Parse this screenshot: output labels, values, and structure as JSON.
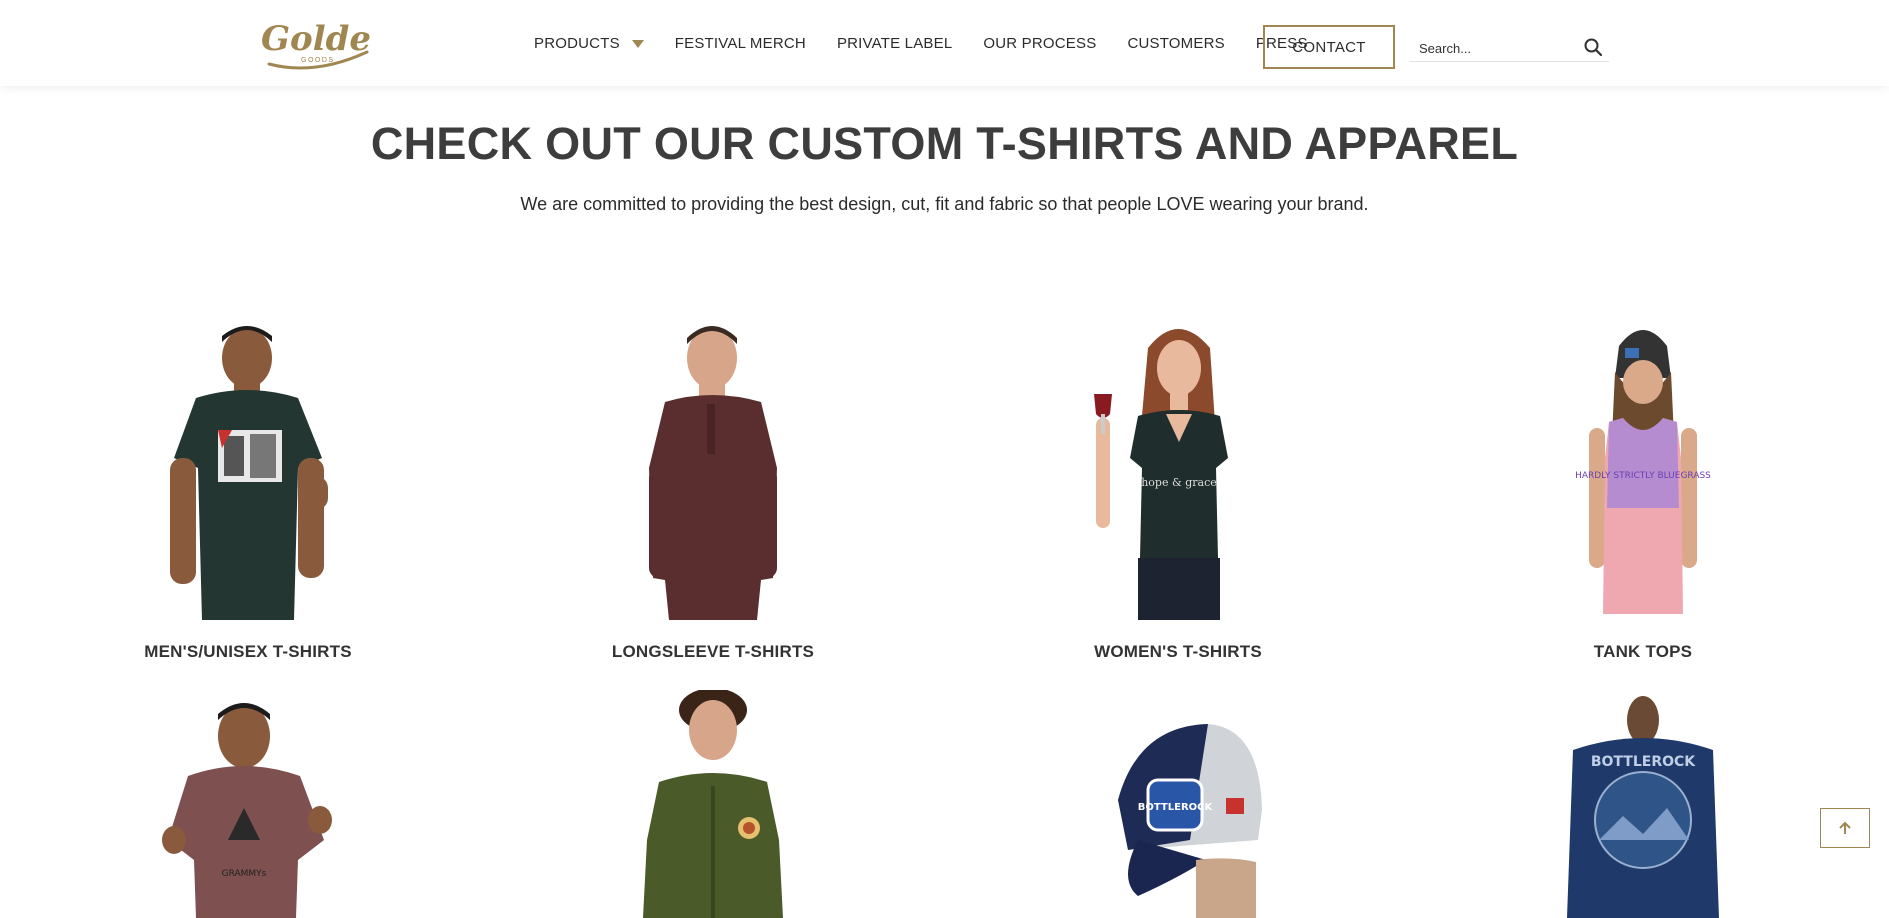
{
  "brand": {
    "logo_text": "Golden",
    "logo_subtext": "GOODS",
    "accent": "#a08650"
  },
  "nav": {
    "items": [
      {
        "label": "PRODUCTS"
      },
      {
        "label": "FESTIVAL MERCH"
      },
      {
        "label": "PRIVATE LABEL"
      },
      {
        "label": "OUR PROCESS"
      },
      {
        "label": "CUSTOMERS"
      },
      {
        "label": "PRESS"
      }
    ],
    "contact_label": "CONTACT"
  },
  "search": {
    "placeholder": "Search..."
  },
  "hero": {
    "title": "CHECK OUT OUR CUSTOM T-SHIRTS AND APPAREL",
    "subtitle": "We are committed to providing the best design, cut, fit and fabric so that people LOVE wearing your brand."
  },
  "products": [
    {
      "label": "MEN'S/UNISEX T-SHIRTS"
    },
    {
      "label": "LONGSLEEVE T-SHIRTS"
    },
    {
      "label": "WOMEN'S T-SHIRTS"
    },
    {
      "label": "TANK TOPS"
    },
    {
      "label": ""
    },
    {
      "label": ""
    },
    {
      "label": ""
    },
    {
      "label": ""
    }
  ],
  "product_art": [
    {
      "shirt_text": ""
    },
    {
      "shirt_text": ""
    },
    {
      "shirt_text": "hope & grace"
    },
    {
      "shirt_text": "HARDLY STRICTLY BLUEGRASS"
    },
    {
      "shirt_text": "GRAMMYs"
    },
    {
      "shirt_text": ""
    },
    {
      "shirt_text": "BOTTLEROCK"
    },
    {
      "shirt_text": "BOTTLEROCK"
    }
  ]
}
